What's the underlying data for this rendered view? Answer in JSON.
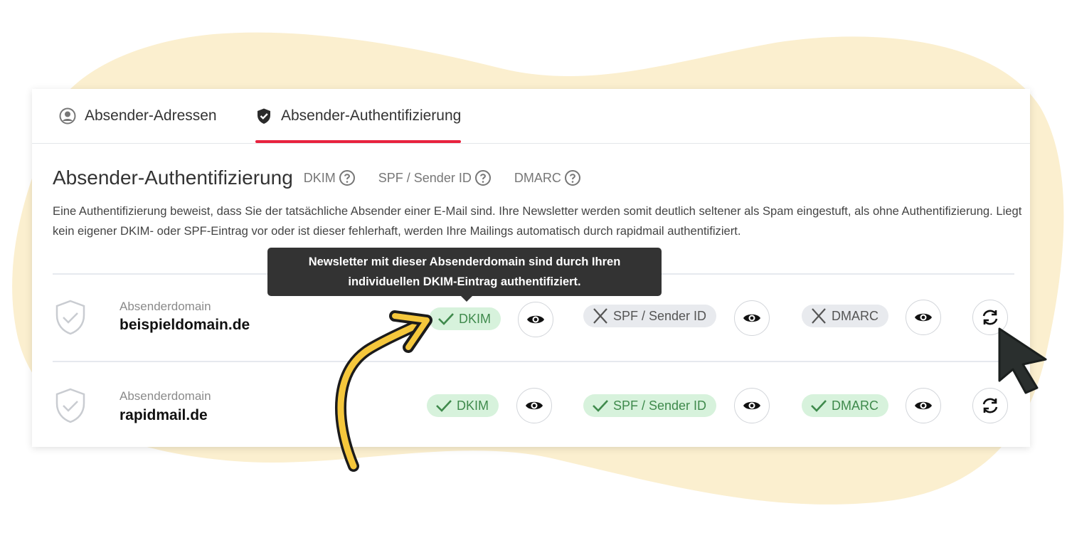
{
  "colors": {
    "blob": "#fbefcf",
    "accent_red": "#e8233e",
    "ok_bg": "#d7f2dc",
    "ok_text": "#3f8a4c",
    "bad_bg": "#e8eaee",
    "tooltip_bg": "#333333",
    "arrow_yellow": "#f5c73c"
  },
  "tabs": [
    {
      "label": "Absender-Adressen",
      "icon": "user-circle-icon",
      "active": false
    },
    {
      "label": "Absender-Authentifizierung",
      "icon": "shield-check-icon",
      "active": true
    }
  ],
  "section": {
    "title": "Absender-Authentifizierung",
    "help_links": [
      {
        "label": "DKIM",
        "icon": "question-circle-icon"
      },
      {
        "label": "SPF / Sender ID",
        "icon": "question-circle-icon"
      },
      {
        "label": "DMARC",
        "icon": "question-circle-icon"
      }
    ],
    "description": "Eine Authentifizierung beweist, dass Sie der tatsächliche Absender einer E-Mail sind. Ihre Newsletter werden somit deutlich seltener als Spam eingestuft, als ohne Authentifizierung. Liegt kein eigener DKIM- oder SPF-Eintrag vor oder ist dieser fehlerhaft, werden Ihre Mailings automatisch durch rapidmail authentifiziert."
  },
  "tooltip": {
    "line1": "Newsletter mit dieser Absenderdomain sind durch Ihren",
    "line2": "individuellen DKIM-Eintrag authentifiziert."
  },
  "domains": [
    {
      "label": "Absenderdomain",
      "name": "beispieldomain.de",
      "checks": [
        {
          "label": "DKIM",
          "status": "ok"
        },
        {
          "label": "SPF / Sender ID",
          "status": "fail"
        },
        {
          "label": "DMARC",
          "status": "fail"
        }
      ]
    },
    {
      "label": "Absenderdomain",
      "name": "rapidmail.de",
      "checks": [
        {
          "label": "DKIM",
          "status": "ok"
        },
        {
          "label": "SPF / Sender ID",
          "status": "ok"
        },
        {
          "label": "DMARC",
          "status": "ok"
        }
      ]
    }
  ],
  "icons": {
    "view": "eye-icon",
    "refresh": "refresh-icon",
    "ok": "check-icon",
    "fail": "x-icon",
    "domain": "shield-outline-icon"
  }
}
